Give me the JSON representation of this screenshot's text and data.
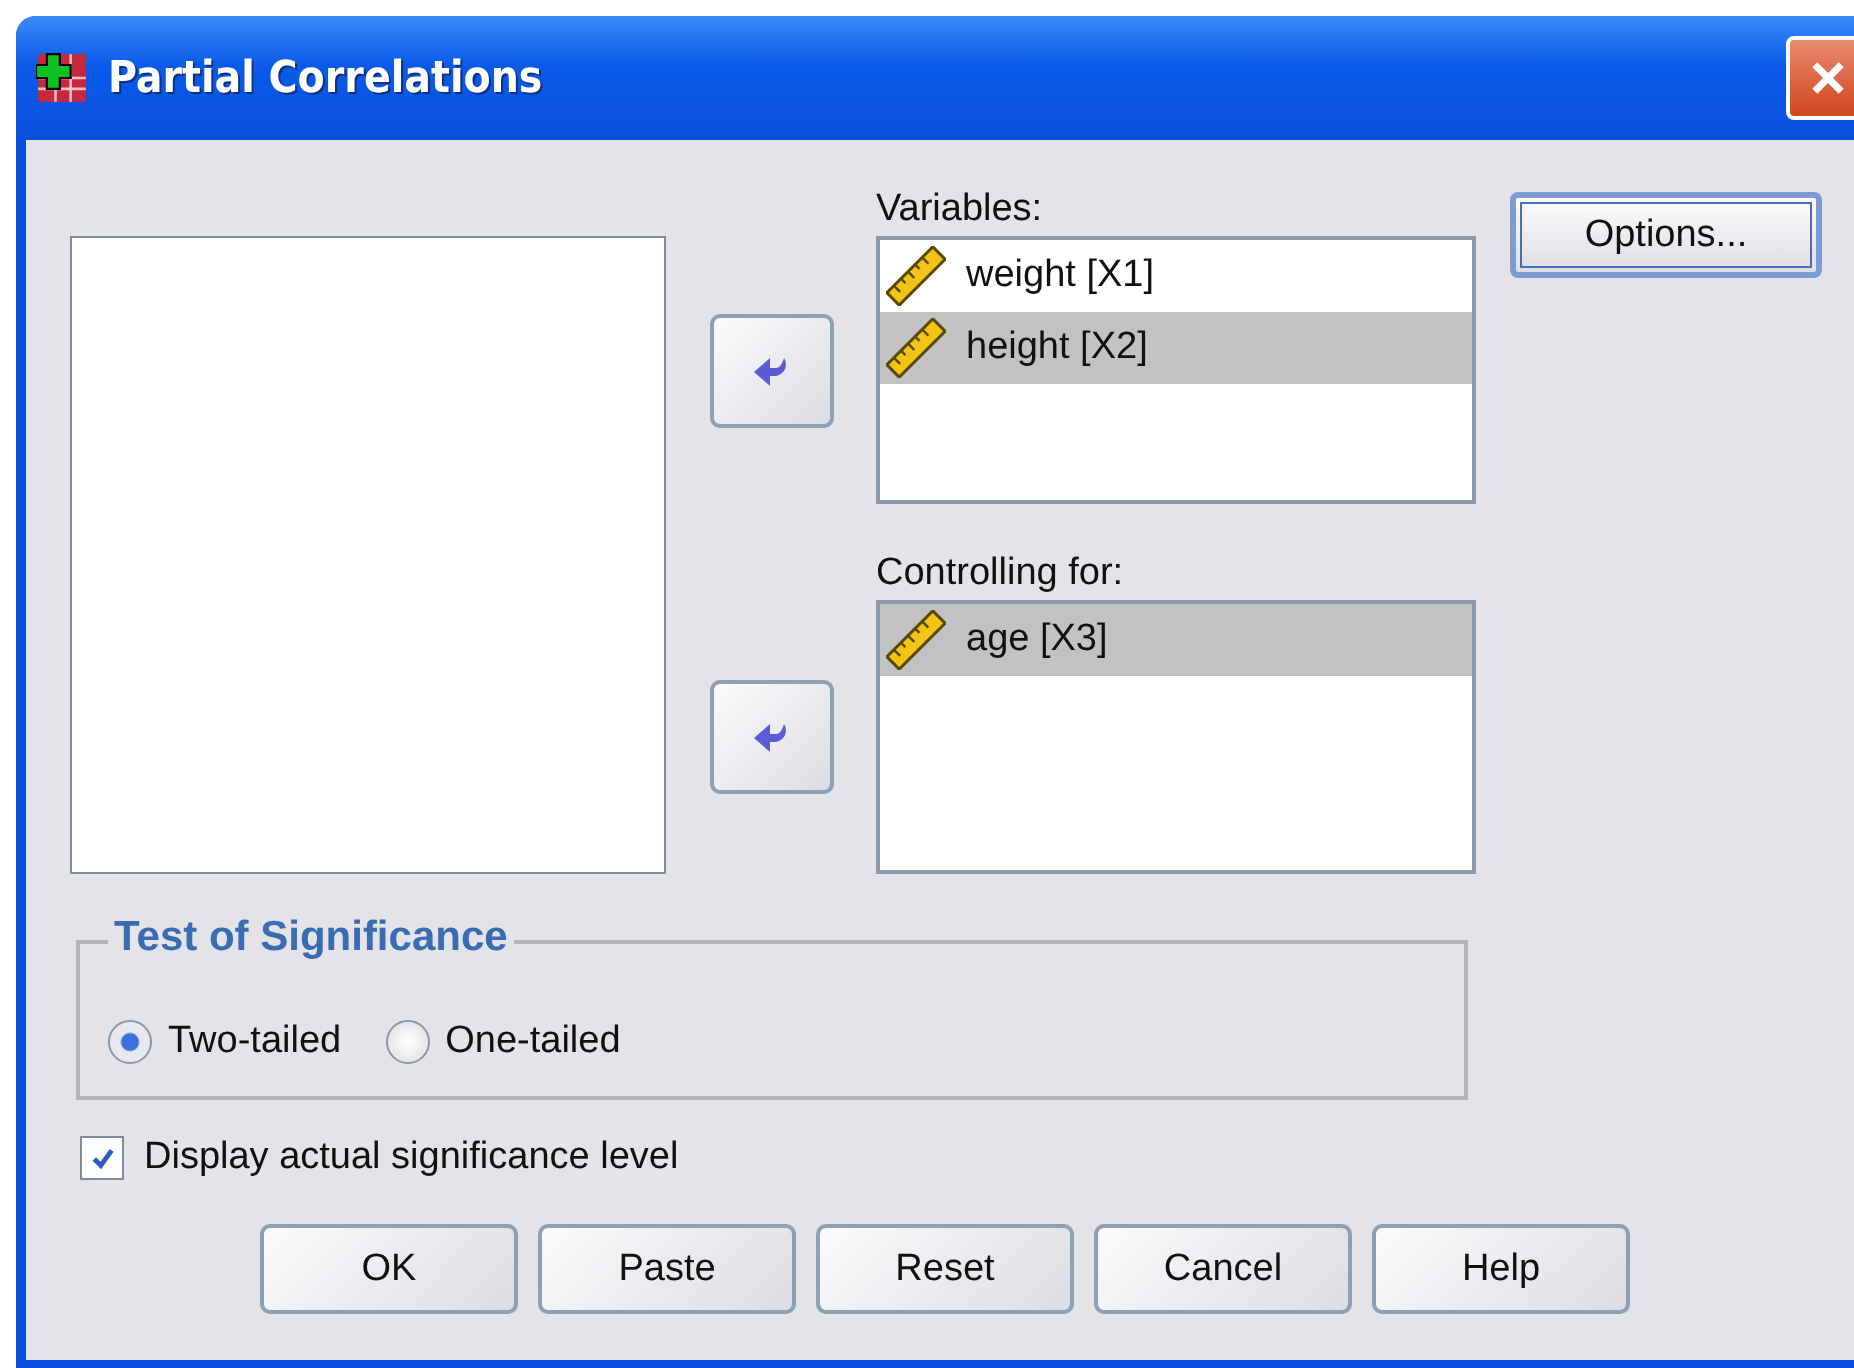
{
  "window": {
    "title": "Partial Correlations"
  },
  "variables": {
    "label": "Variables:",
    "items": [
      {
        "name": "weight [X1]",
        "selected": false
      },
      {
        "name": "height [X2]",
        "selected": true
      }
    ]
  },
  "controlling_for": {
    "label": "Controlling for:",
    "items": [
      {
        "name": "age [X3]",
        "selected": true
      }
    ]
  },
  "options_button": "Options...",
  "test_of_significance": {
    "title": "Test of Significance",
    "options": [
      {
        "label": "Two-tailed",
        "selected": true
      },
      {
        "label": "One-tailed",
        "selected": false
      }
    ]
  },
  "display_actual_significance": {
    "label": "Display actual significance level",
    "checked": true
  },
  "buttons": [
    "OK",
    "Paste",
    "Reset",
    "Cancel",
    "Help"
  ]
}
